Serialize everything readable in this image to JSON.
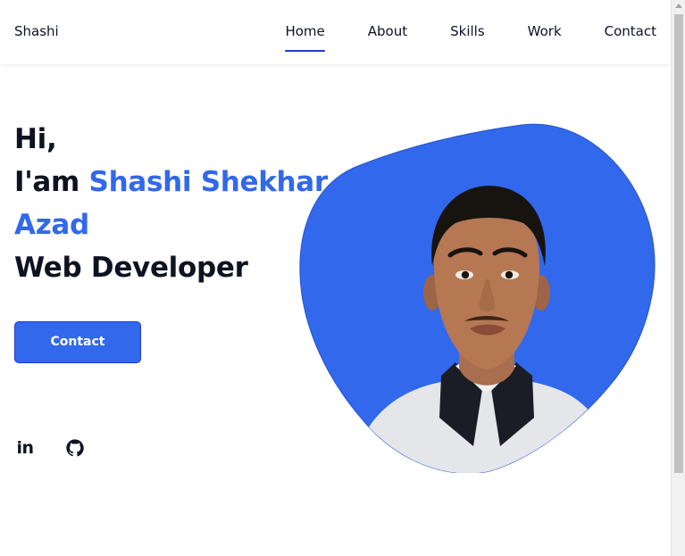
{
  "header": {
    "logo": "Shashi",
    "nav": [
      {
        "label": "Home",
        "active": true
      },
      {
        "label": "About",
        "active": false
      },
      {
        "label": "Skills",
        "active": false
      },
      {
        "label": "Work",
        "active": false
      },
      {
        "label": "Contact",
        "active": false
      }
    ]
  },
  "hero": {
    "greeting": "Hi,",
    "intro_prefix": "I'am ",
    "name": "Shashi Shekhar Azad",
    "role": "Web Developer",
    "button_label": "Contact"
  },
  "social": {
    "linkedin_label": "in",
    "linkedin_icon": "linkedin-icon",
    "github_icon": "github-icon"
  },
  "colors": {
    "accent": "#3268eb",
    "text": "#0f1221",
    "nav_underline": "#1e3bd8"
  }
}
